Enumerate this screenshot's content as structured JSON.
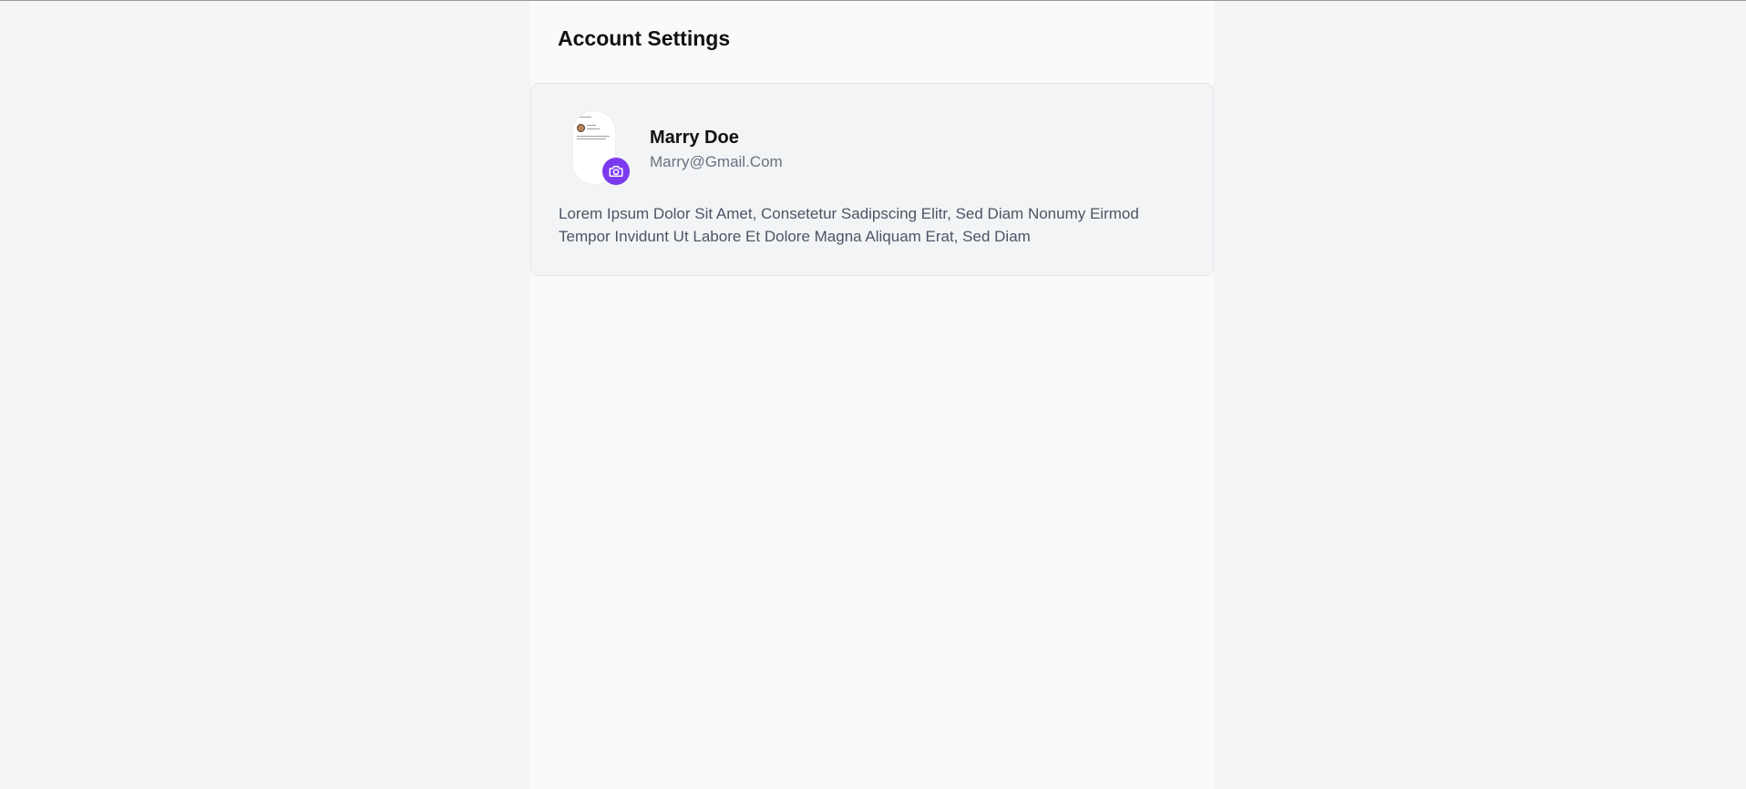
{
  "page": {
    "title": "Account Settings"
  },
  "profile": {
    "name": "Marry Doe",
    "email": "Marry@Gmail.Com",
    "bio": "Lorem Ipsum Dolor Sit Amet, Consetetur Sadipscing Elitr, Sed Diam Nonumy Eirmod Tempor Invidunt Ut Labore Et Dolore Magna Aliquam Erat, Sed Diam",
    "avatar_icon": "camera-icon",
    "accent_color": "#7c3aed"
  }
}
